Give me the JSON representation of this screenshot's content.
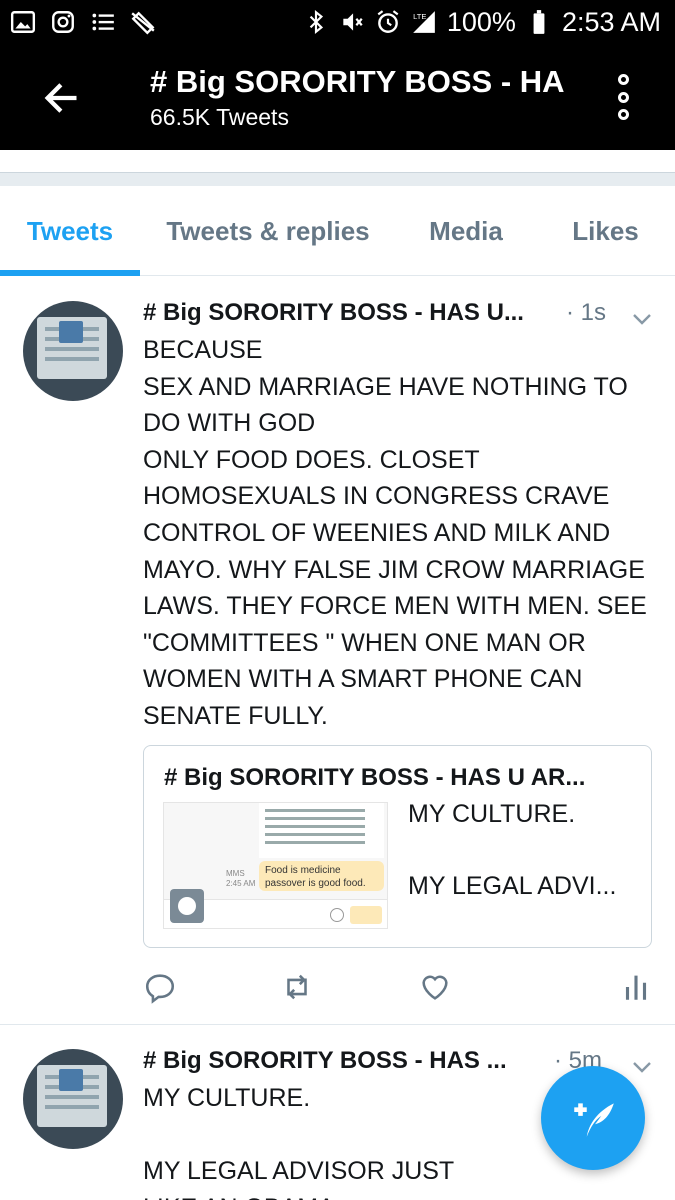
{
  "status_bar": {
    "battery": "100%",
    "time": "2:53 AM",
    "network": "LTE"
  },
  "header": {
    "title": "# Big SORORITY BOSS - HA",
    "subtitle": "66.5K Tweets"
  },
  "tabs": [
    {
      "label": "Tweets",
      "active": true
    },
    {
      "label": "Tweets & replies",
      "active": false
    },
    {
      "label": "Media",
      "active": false
    },
    {
      "label": "Likes",
      "active": false
    }
  ],
  "tweets": [
    {
      "name": "# Big SORORITY BOSS - HAS U...",
      "time": "· 1s",
      "text": "BECAUSE\nSEX AND MARRIAGE HAVE NOTHING TO DO WITH GOD\nONLY FOOD DOES. CLOSET HOMOSEXUALS IN CONGRESS CRAVE CONTROL OF WEENIES AND MILK AND MAYO. WHY FALSE JIM CROW MARRIAGE LAWS. THEY FORCE MEN WITH MEN. SEE \"COMMITTEES \" WHEN ONE MAN OR WOMEN WITH A SMART PHONE CAN SENATE FULLY.",
      "card": {
        "title": "# Big SORORITY BOSS - HAS U AR...",
        "description": "MY CULTURE.\n\nMY LEGAL ADVI...",
        "thumbnail": {
          "bubble_text": "Food is medicine passover is good food.",
          "mms_label": "MMS",
          "mms_time": "2:45 AM"
        }
      }
    },
    {
      "name": "# Big SORORITY BOSS - HAS ...",
      "time": "· 5m",
      "text": "MY CULTURE.\n\nMY LEGAL ADVISOR JUST\nLIKE AN OBAMA"
    }
  ],
  "icons": {
    "back": "arrow-left-icon",
    "overflow": "more-vertical-icon",
    "reply": "reply-icon",
    "retweet": "retweet-icon",
    "like": "heart-icon",
    "analytics": "analytics-icon",
    "compose": "compose-tweet-icon"
  },
  "colors": {
    "accent": "#1da1f2",
    "header_bg": "#000000",
    "muted": "#657786"
  }
}
